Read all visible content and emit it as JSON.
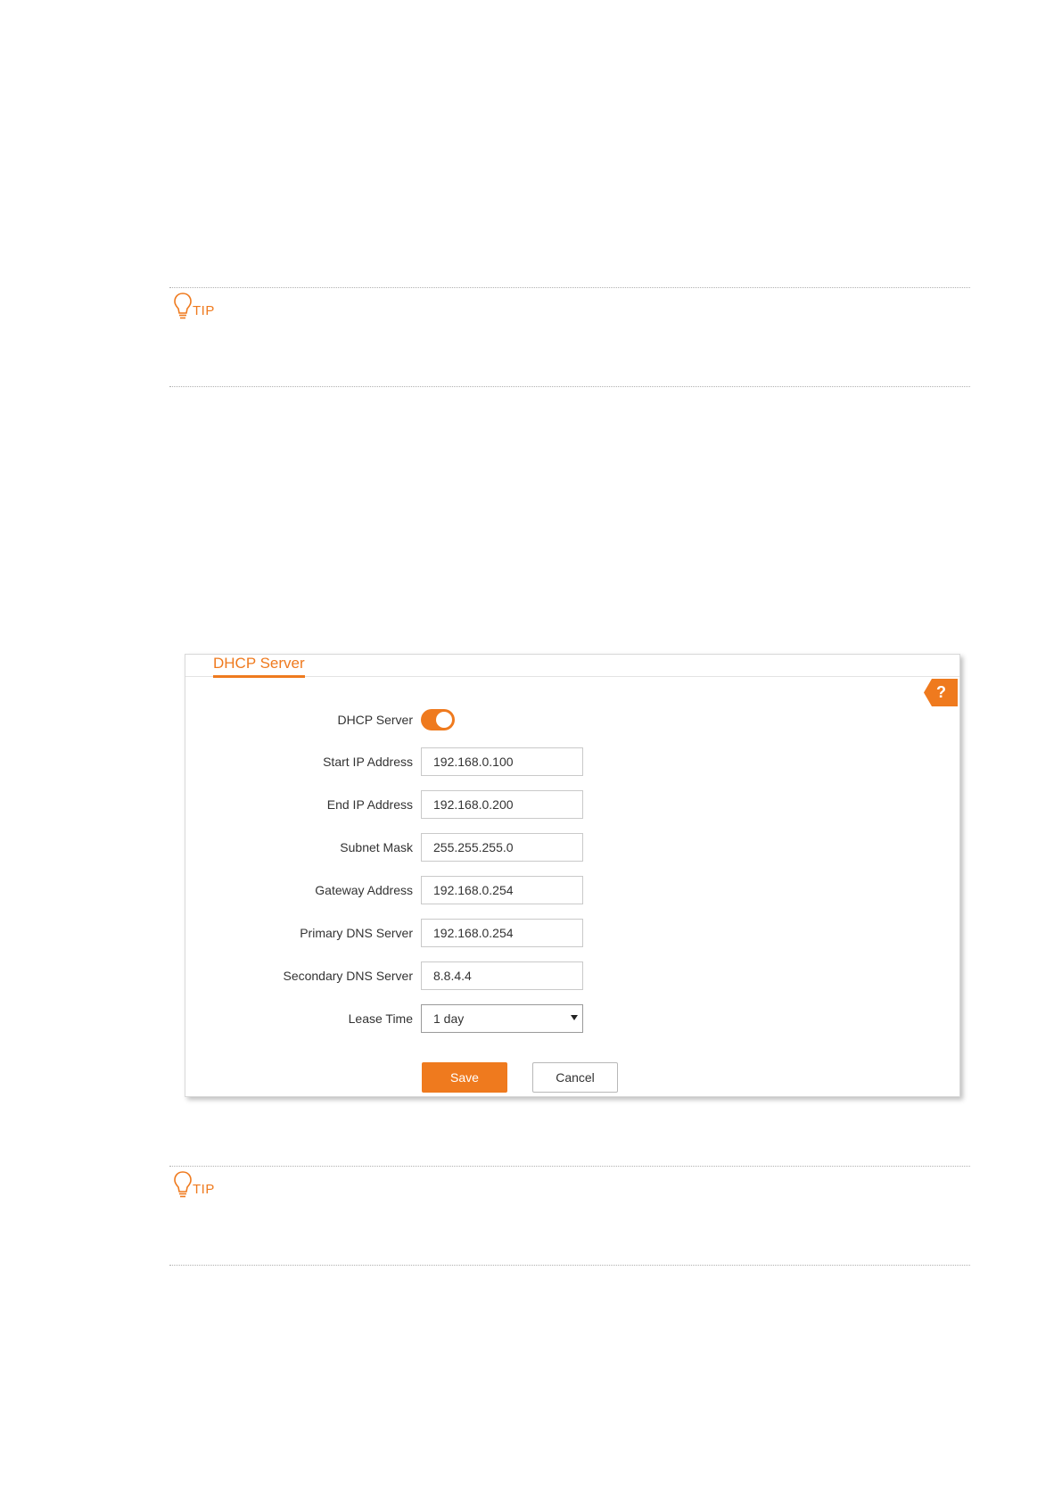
{
  "tips": [
    {
      "label": "TIP"
    },
    {
      "label": "TIP"
    }
  ],
  "panel": {
    "title": "DHCP Server",
    "help_label": "?",
    "fields": {
      "dhcp_server": {
        "label": "DHCP Server",
        "enabled": true
      },
      "start_ip": {
        "label": "Start IP Address",
        "value": "192.168.0.100"
      },
      "end_ip": {
        "label": "End IP Address",
        "value": "192.168.0.200"
      },
      "subnet_mask": {
        "label": "Subnet Mask",
        "value": "255.255.255.0"
      },
      "gateway": {
        "label": "Gateway Address",
        "value": "192.168.0.254"
      },
      "primary_dns": {
        "label": "Primary DNS Server",
        "value": "192.168.0.254"
      },
      "secondary_dns": {
        "label": "Secondary DNS Server",
        "value": "8.8.4.4"
      },
      "lease_time": {
        "label": "Lease Time",
        "value": "1 day"
      }
    },
    "buttons": {
      "save": "Save",
      "cancel": "Cancel"
    }
  },
  "colors": {
    "accent": "#ef7a1e",
    "text": "#333333",
    "border": "#c9c9c9"
  }
}
